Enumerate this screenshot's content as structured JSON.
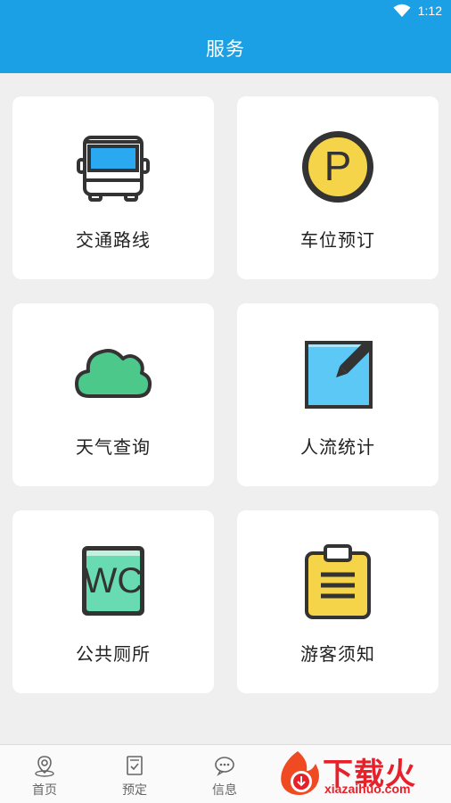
{
  "status_bar": {
    "time": "1:12"
  },
  "header": {
    "title": "服务"
  },
  "services": [
    {
      "label": "交通路线",
      "icon": "bus-icon"
    },
    {
      "label": "车位预订",
      "icon": "parking-icon"
    },
    {
      "label": "天气查询",
      "icon": "cloud-icon"
    },
    {
      "label": "人流统计",
      "icon": "edit-icon"
    },
    {
      "label": "公共厕所",
      "icon": "wc-icon"
    },
    {
      "label": "游客须知",
      "icon": "clipboard-icon"
    }
  ],
  "wc_icon_text": "WC",
  "parking_icon_text": "P",
  "bottom_nav": [
    {
      "label": "首页",
      "icon": "location-icon"
    },
    {
      "label": "预定",
      "icon": "checklist-icon"
    },
    {
      "label": "信息",
      "icon": "chat-icon"
    }
  ],
  "watermark": {
    "title": "下载火",
    "subtitle": "xiazaihuo.com"
  },
  "colors": {
    "primary": "#1ba0e6",
    "background": "#efefef",
    "card": "#ffffff"
  }
}
